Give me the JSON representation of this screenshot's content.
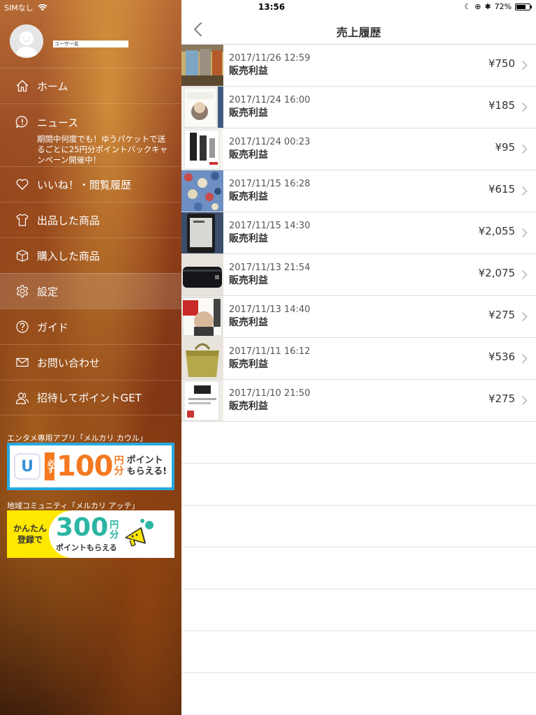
{
  "drawer": {
    "status": {
      "carrier": "SIMなし"
    },
    "user": {
      "name": "ユーザー名"
    },
    "menu": [
      {
        "label": "ホーム"
      },
      {
        "label": "ニュース",
        "sub": "期間中何度でも！ゆうパケットで送るごとに25円分ポイントバックキャンペーン開催中！"
      },
      {
        "label": "いいね！・閲覧履歴"
      },
      {
        "label": "出品した商品"
      },
      {
        "label": "購入した商品"
      },
      {
        "label": "設定"
      },
      {
        "label": "ガイド"
      },
      {
        "label": "お問い合わせ"
      },
      {
        "label": "招待してポイントGET"
      }
    ],
    "promo1": {
      "label": "エンタメ専用アプリ「メルカリ カウル」",
      "logo": "U",
      "badge": "必ず",
      "amount": "100",
      "unit_top": "円",
      "unit_bottom": "分",
      "line1": "ポイント",
      "line2": "もらえる!"
    },
    "promo2": {
      "label": "地域コミュニティ「メルカリ アッテ」",
      "circle_line1": "かんたん",
      "circle_line2": "登録で",
      "amount": "300",
      "unit_top": "円",
      "unit_bottom": "分",
      "caption": "ポイントもらえる"
    }
  },
  "status_bar": {
    "time": "13:56",
    "battery": "72%",
    "battery_level": 0.72
  },
  "header": {
    "title": "売上履歴"
  },
  "sales": [
    {
      "date": "2017/11/26 12:59",
      "type": "販売利益",
      "price": "¥750"
    },
    {
      "date": "2017/11/24 16:00",
      "type": "販売利益",
      "price": "¥185"
    },
    {
      "date": "2017/11/24 00:23",
      "type": "販売利益",
      "price": "¥95"
    },
    {
      "date": "2017/11/15 16:28",
      "type": "販売利益",
      "price": "¥615"
    },
    {
      "date": "2017/11/15 14:30",
      "type": "販売利益",
      "price": "¥2,055"
    },
    {
      "date": "2017/11/13 21:54",
      "type": "販売利益",
      "price": "¥2,075"
    },
    {
      "date": "2017/11/13 14:40",
      "type": "販売利益",
      "price": "¥275"
    },
    {
      "date": "2017/11/11 16:12",
      "type": "販売利益",
      "price": "¥536"
    },
    {
      "date": "2017/11/10 21:50",
      "type": "販売利益",
      "price": "¥275"
    }
  ],
  "colors": {
    "promo1_accent": "#f47920",
    "promo1_border": "#24a9e1",
    "promo2_accent": "#2bb5a3",
    "promo2_bg": "#ffe800"
  }
}
